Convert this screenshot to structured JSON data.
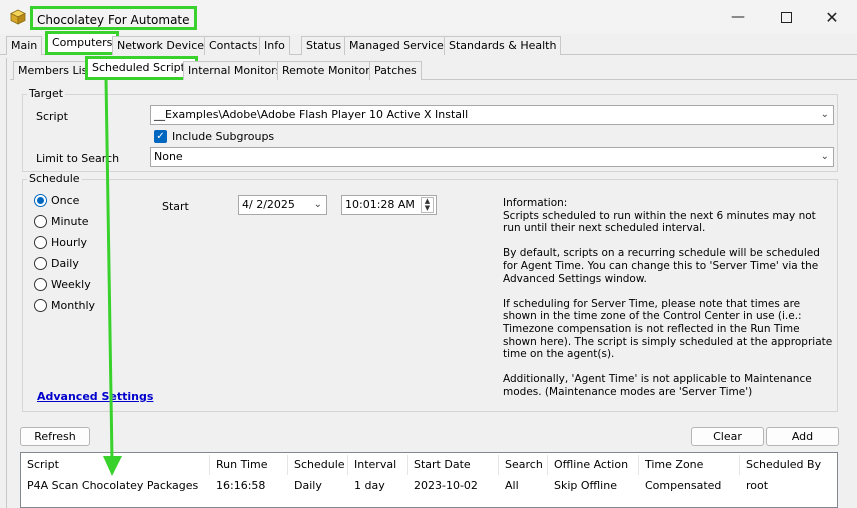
{
  "window": {
    "title": "Chocolatey For Automate",
    "controls": [
      "minimize",
      "maximize",
      "close"
    ]
  },
  "main_tabs": [
    "Main",
    "Computers",
    "Network Devices",
    "Contacts",
    "Info",
    "Status",
    "Managed Services",
    "Standards & Health"
  ],
  "sub_tabs": [
    "Members List",
    "Scheduled Scripts",
    "Internal Monitors",
    "Remote Monitors",
    "Patches"
  ],
  "target": {
    "legend": "Target",
    "script_label": "Script",
    "script_value": "__Examples\\Adobe\\Adobe Flash Player 10 Active X Install",
    "include_subgroups_label": "Include Subgroups",
    "limit_label": "Limit to Search",
    "limit_value": "None"
  },
  "schedule": {
    "legend": "Schedule",
    "options": [
      "Once",
      "Minute",
      "Hourly",
      "Daily",
      "Weekly",
      "Monthly"
    ],
    "selected": "Once",
    "start_label": "Start",
    "start_date": "4/  2/2025",
    "start_time": "10:01:28 AM"
  },
  "info": "Information:\nScripts scheduled to run within the next 6 minutes may not run until their next scheduled interval.\n\nBy default, scripts on a recurring schedule will be scheduled for Agent Time. You can change this to 'Server Time' via the Advanced Settings window.\n\nIf scheduling for Server Time, please note that times are shown in the time zone of the Control Center in use (i.e.: Timezone compensation is not reflected in the Run Time shown here). The script is simply scheduled at the appropriate time on the agent(s).\n\nAdditionally, 'Agent Time' is not applicable to Maintenance modes. (Maintenance modes are 'Server Time')",
  "advanced_settings": "Advanced Settings",
  "buttons": {
    "refresh": "Refresh",
    "clear": "Clear",
    "add": "Add"
  },
  "table": {
    "columns": [
      "Script",
      "Run Time",
      "Schedule",
      "Interval",
      "Start Date",
      "Search",
      "Offline Action",
      "Time Zone",
      "Scheduled By"
    ],
    "rows": [
      [
        "P4A Scan Chocolatey Packages",
        "16:16:58",
        "Daily",
        "1 day",
        "2023-10-02",
        "All",
        "Skip Offline",
        "Compensated",
        "root"
      ]
    ]
  },
  "colors": {
    "highlight": "#39d12b",
    "accent": "#0067c0",
    "link": "#0000cc"
  },
  "icons": {
    "app": "package-box-icon",
    "minimize": "minimize-icon",
    "maximize": "maximize-icon",
    "close": "close-icon"
  }
}
